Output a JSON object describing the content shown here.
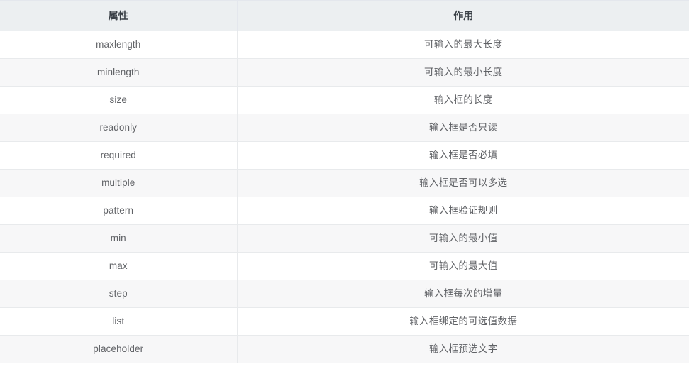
{
  "table": {
    "columns": [
      {
        "key": "attribute",
        "label": "属性"
      },
      {
        "key": "description",
        "label": "作用"
      }
    ],
    "rows": [
      {
        "attribute": "maxlength",
        "description": "可输入的最大长度"
      },
      {
        "attribute": "minlength",
        "description": "可输入的最小长度"
      },
      {
        "attribute": "size",
        "description": "输入框的长度"
      },
      {
        "attribute": "readonly",
        "description": "输入框是否只读"
      },
      {
        "attribute": "required",
        "description": "输入框是否必填"
      },
      {
        "attribute": "multiple",
        "description": "输入框是否可以多选"
      },
      {
        "attribute": "pattern",
        "description": "输入框验证规则"
      },
      {
        "attribute": "min",
        "description": "可输入的最小值"
      },
      {
        "attribute": "max",
        "description": "可输入的最大值"
      },
      {
        "attribute": "step",
        "description": "输入框每次的增量"
      },
      {
        "attribute": "list",
        "description": "输入框绑定的可选值数据"
      },
      {
        "attribute": "placeholder",
        "description": "输入框预选文字"
      }
    ]
  },
  "theme": {
    "header_background": "#eceff1",
    "header_text": "#3a4047",
    "body_text": "#606266",
    "row_odd_background": "#ffffff",
    "row_even_background": "#f7f7f8",
    "border_color": "#e4e7ed"
  }
}
